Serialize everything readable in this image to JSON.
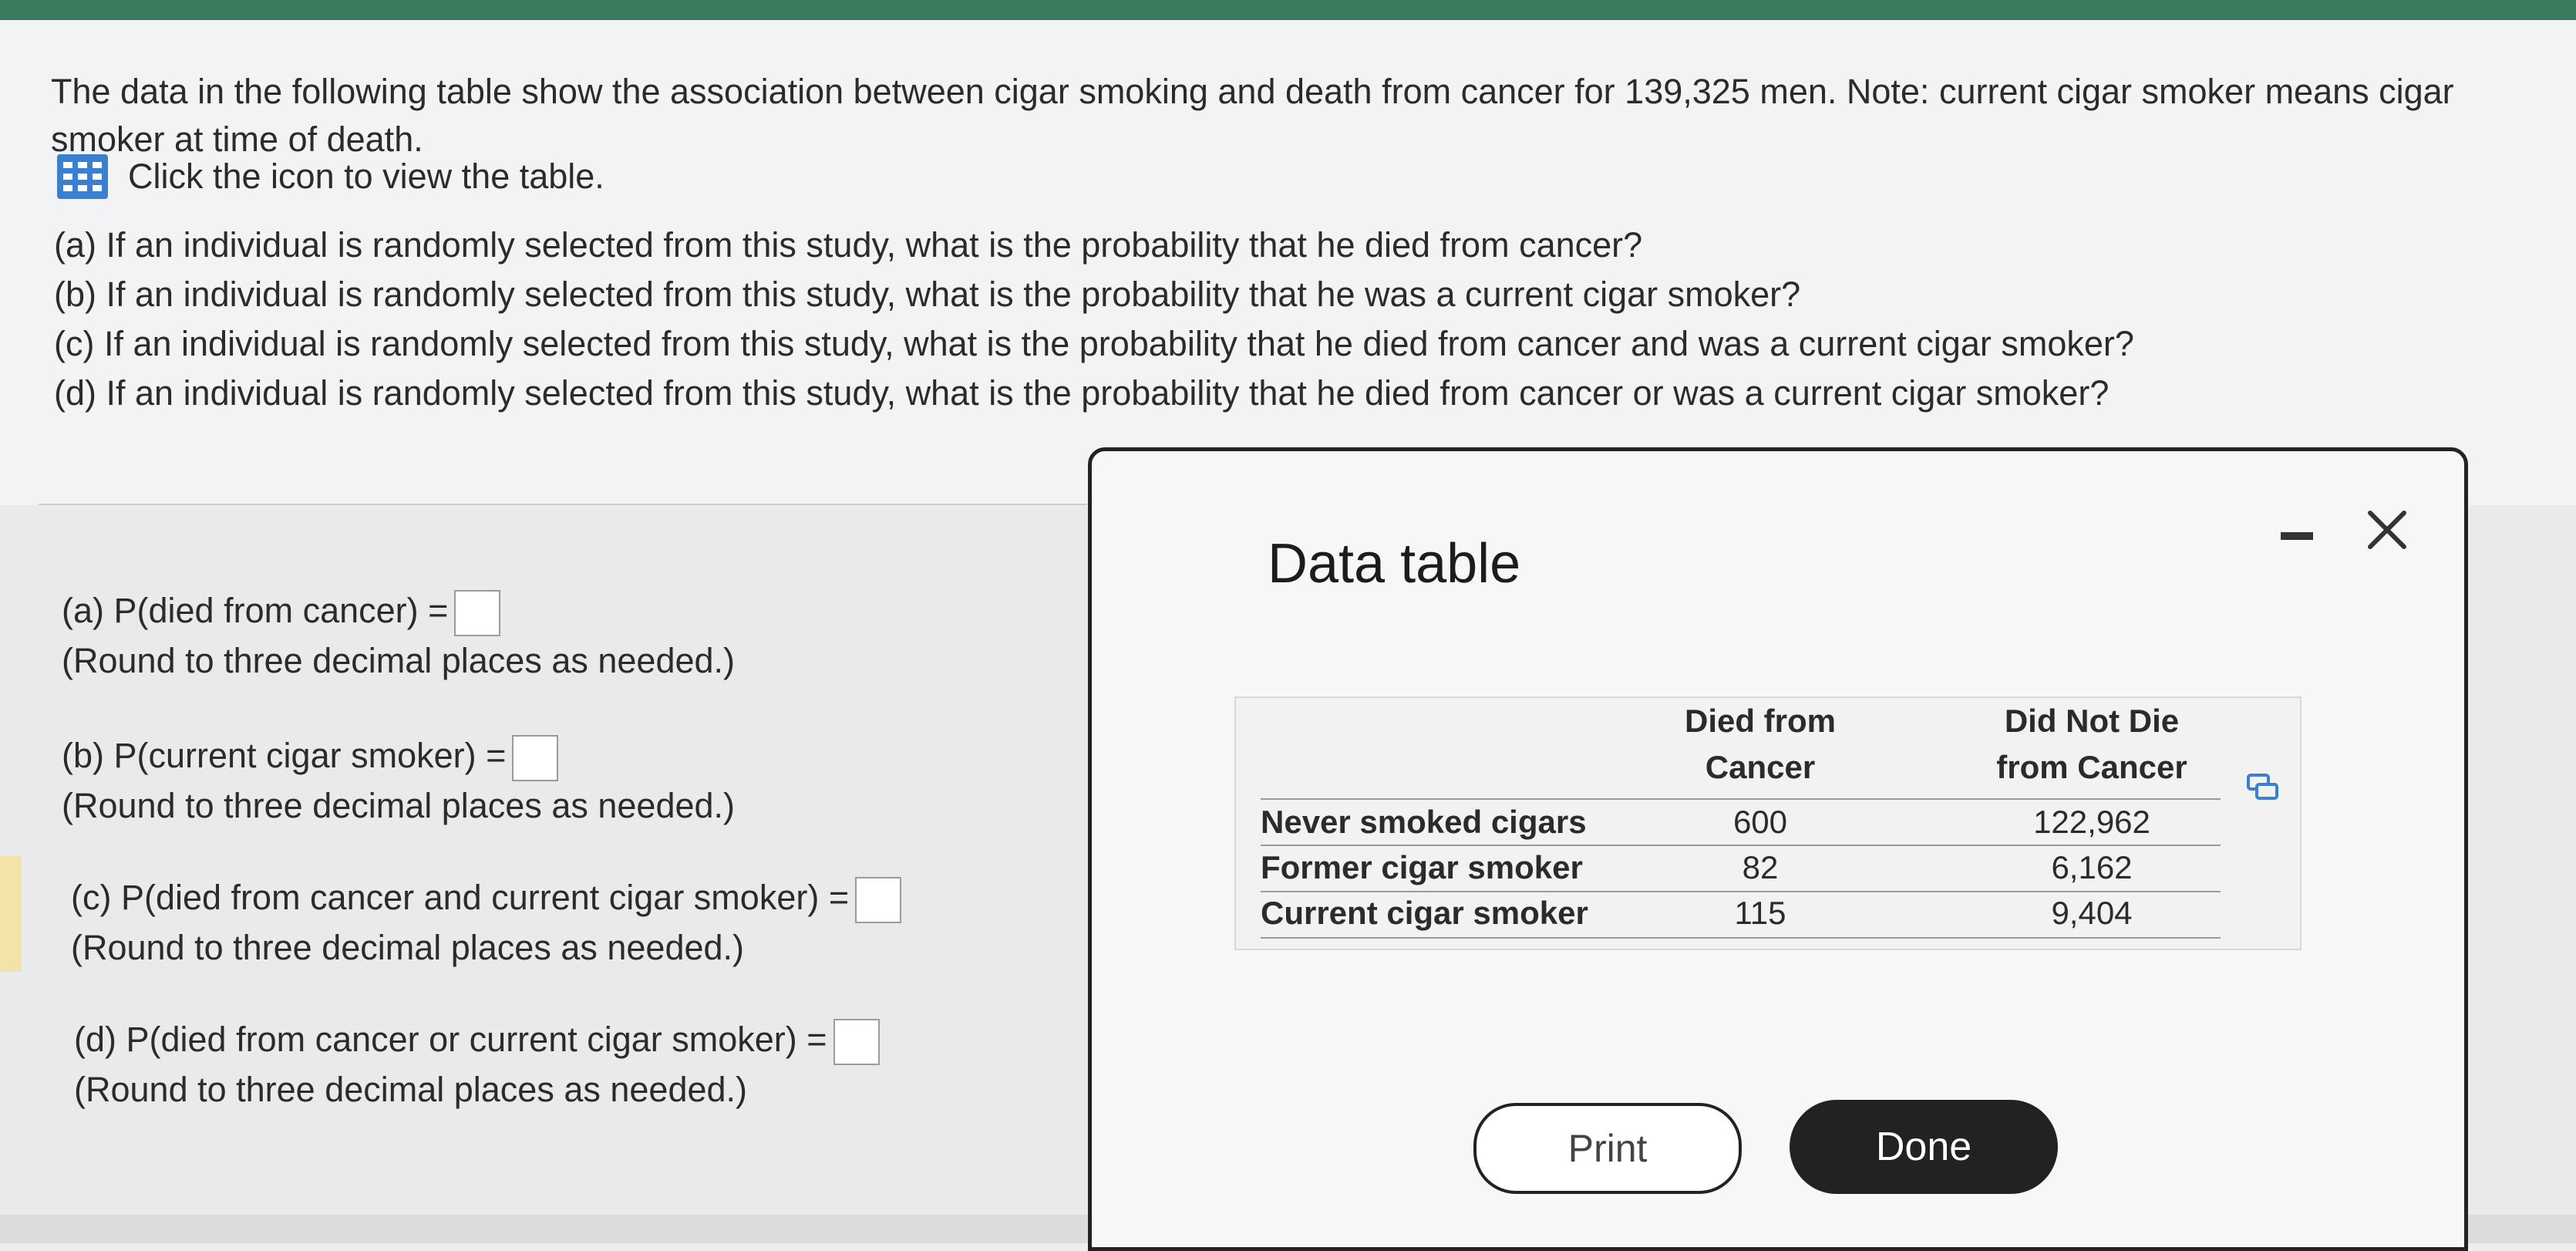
{
  "question": {
    "intro": "The data in the following table show the association between cigar smoking and death from cancer for 139,325 men. Note: current cigar smoker means cigar smoker at time of death.",
    "icon_name": "table-grid-icon",
    "icon_hint": "Click the icon to view the table.",
    "parts": [
      "(a) If an individual is randomly selected from this study, what is the probability that he died from cancer?",
      "(b) If an individual is randomly selected from this study, what is the probability that he was a current cigar smoker?",
      "(c) If an individual is randomly selected from this study, what is the probability that he died from cancer and was a current cigar smoker?",
      "(d) If an individual is randomly selected from this study, what is the probability that he died from cancer or was a current cigar smoker?"
    ]
  },
  "answers": [
    {
      "label": "(a) P(died from cancer) =",
      "value": "",
      "hint": "(Round to three decimal places as needed.)"
    },
    {
      "label": "(b) P(current cigar smoker) =",
      "value": "",
      "hint": "(Round to three decimal places as needed.)"
    },
    {
      "label": "(c) P(died from cancer and current cigar smoker) =",
      "value": "",
      "hint": "(Round to three decimal places as needed.)"
    },
    {
      "label": "(d) P(died from cancer or current cigar smoker) =",
      "value": "",
      "hint": "(Round to three decimal places as needed.)"
    }
  ],
  "dialog": {
    "title": "Data table",
    "minimize_icon": "minimize-icon",
    "close_icon": "close-icon",
    "table": {
      "columns": [
        {
          "line1": "Died from",
          "line2": "Cancer"
        },
        {
          "line1": "Did Not Die",
          "line2": "from Cancer"
        }
      ],
      "rows": [
        {
          "label": "Never smoked cigars",
          "died": "600",
          "not_died": "122,962"
        },
        {
          "label": "Former cigar smoker",
          "died": "82",
          "not_died": "6,162"
        },
        {
          "label": "Current cigar smoker",
          "died": "115",
          "not_died": "9,404"
        }
      ]
    },
    "copy_icon": "copy-icon",
    "print_label": "Print",
    "done_label": "Done"
  },
  "colors": {
    "accent_bar": "#3b7a5f",
    "icon_blue": "#3a7fd0",
    "done_button": "#222222"
  }
}
